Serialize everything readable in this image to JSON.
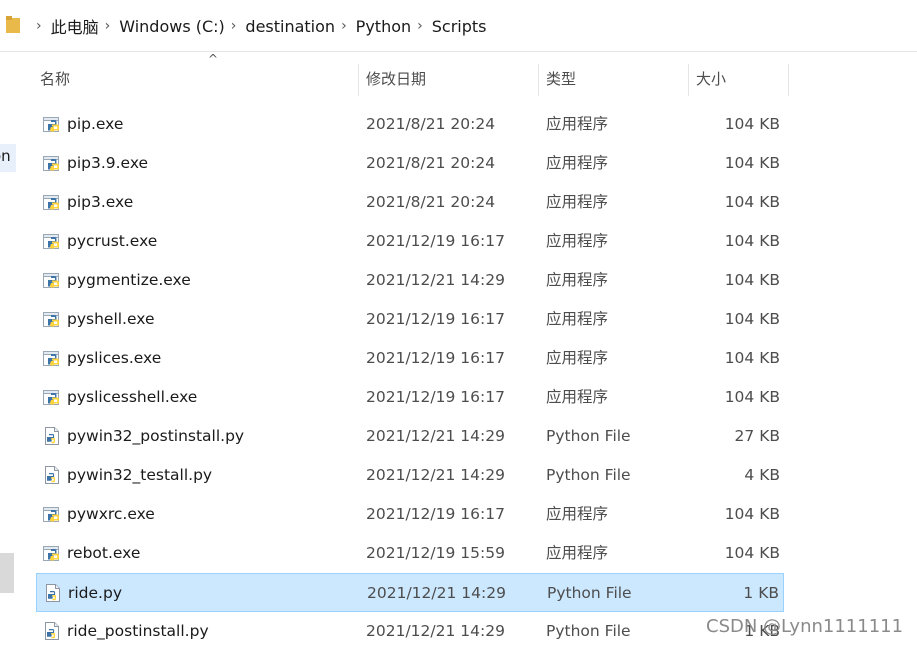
{
  "breadcrumb": {
    "items": [
      "此电脑",
      "Windows (C:)",
      "destination",
      "Python",
      "Scripts"
    ],
    "separator": "›"
  },
  "nav_fragment": "on",
  "columns": {
    "name": "名称",
    "date": "修改日期",
    "type": "类型",
    "size": "大小",
    "sort_indicator": "^"
  },
  "files": [
    {
      "name": "pip.exe",
      "date": "2021/8/21 20:24",
      "type": "应用程序",
      "size": "104 KB",
      "icon": "python-exe-icon"
    },
    {
      "name": "pip3.9.exe",
      "date": "2021/8/21 20:24",
      "type": "应用程序",
      "size": "104 KB",
      "icon": "python-exe-icon"
    },
    {
      "name": "pip3.exe",
      "date": "2021/8/21 20:24",
      "type": "应用程序",
      "size": "104 KB",
      "icon": "python-exe-icon"
    },
    {
      "name": "pycrust.exe",
      "date": "2021/12/19 16:17",
      "type": "应用程序",
      "size": "104 KB",
      "icon": "python-exe-icon"
    },
    {
      "name": "pygmentize.exe",
      "date": "2021/12/21 14:29",
      "type": "应用程序",
      "size": "104 KB",
      "icon": "python-exe-icon"
    },
    {
      "name": "pyshell.exe",
      "date": "2021/12/19 16:17",
      "type": "应用程序",
      "size": "104 KB",
      "icon": "python-exe-icon"
    },
    {
      "name": "pyslices.exe",
      "date": "2021/12/19 16:17",
      "type": "应用程序",
      "size": "104 KB",
      "icon": "python-exe-icon"
    },
    {
      "name": "pyslicesshell.exe",
      "date": "2021/12/19 16:17",
      "type": "应用程序",
      "size": "104 KB",
      "icon": "python-exe-icon"
    },
    {
      "name": "pywin32_postinstall.py",
      "date": "2021/12/21 14:29",
      "type": "Python File",
      "size": "27 KB",
      "icon": "python-file-icon"
    },
    {
      "name": "pywin32_testall.py",
      "date": "2021/12/21 14:29",
      "type": "Python File",
      "size": "4 KB",
      "icon": "python-file-icon"
    },
    {
      "name": "pywxrc.exe",
      "date": "2021/12/19 16:17",
      "type": "应用程序",
      "size": "104 KB",
      "icon": "python-exe-icon"
    },
    {
      "name": "rebot.exe",
      "date": "2021/12/19 15:59",
      "type": "应用程序",
      "size": "104 KB",
      "icon": "python-exe-icon"
    },
    {
      "name": "ride.py",
      "date": "2021/12/21 14:29",
      "type": "Python File",
      "size": "1 KB",
      "icon": "python-file-icon",
      "selected": true
    },
    {
      "name": "ride_postinstall.py",
      "date": "2021/12/21 14:29",
      "type": "Python File",
      "size": "1 KB",
      "icon": "python-file-icon"
    }
  ],
  "watermark": "CSDN @Lynn1111111",
  "colors": {
    "selection_bg": "#cce8ff",
    "selection_border": "#99d1ff",
    "python_blue": "#3c74a8",
    "python_yellow": "#ffd43b"
  }
}
